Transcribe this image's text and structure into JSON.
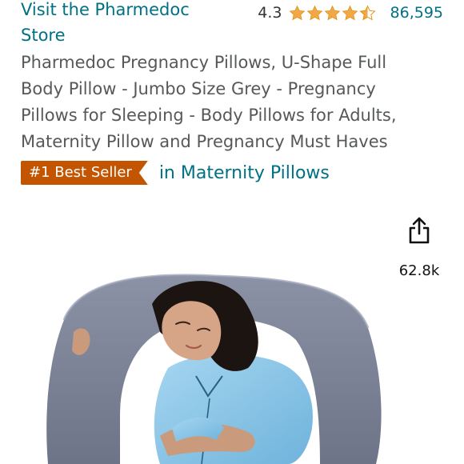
{
  "store": {
    "link_line1": "Visit the Pharmedoc",
    "link_line2": "Store"
  },
  "rating": {
    "value": "4.3",
    "stars_filled": 4.3,
    "star_color": "#f3a847",
    "review_count": "86,595"
  },
  "product": {
    "title_lines": [
      "Pharmedoc Pregnancy Pillows, U-Shape Full",
      "Body Pillow - Jumbo Size Grey - Pregnancy",
      "Pillows for Sleeping - Body Pillows for Adults,",
      "Maternity Pillow and Pregnancy Must Haves"
    ]
  },
  "bestseller": {
    "badge_label": "#1 Best Seller",
    "badge_color": "#c45500",
    "category_label": "in Maternity Pillows"
  },
  "share": {
    "icon": "share-icon",
    "count": "62.8k"
  },
  "colors": {
    "link": "#007185",
    "body_text": "#565959",
    "pillow": "#7d8396",
    "shirt": "#8ec8e8"
  }
}
